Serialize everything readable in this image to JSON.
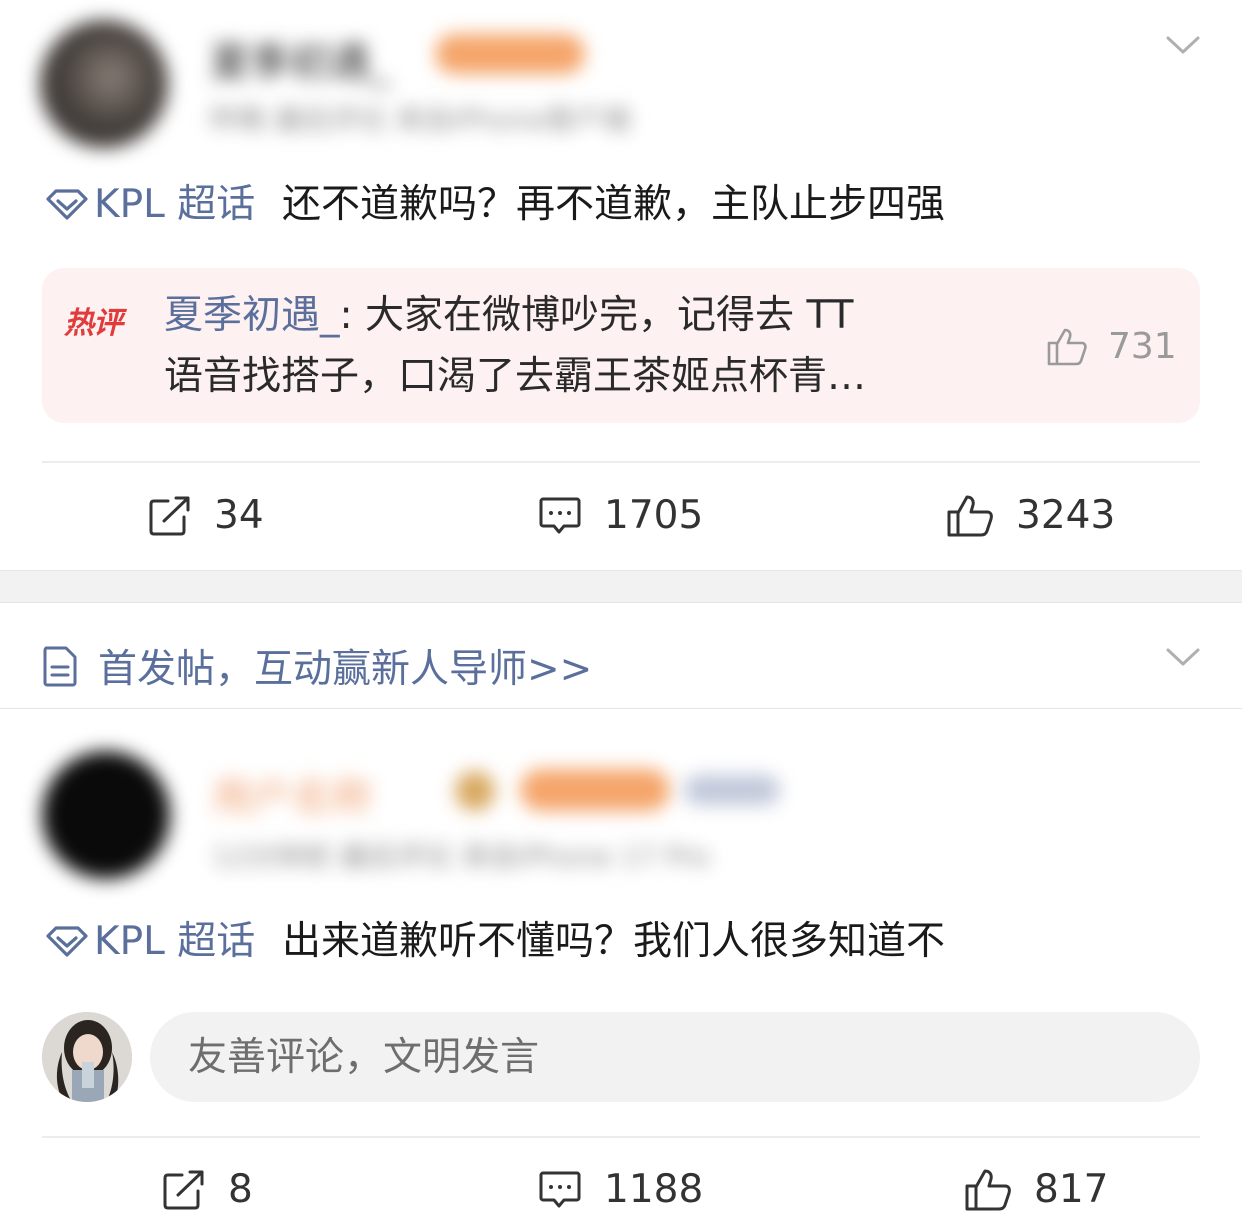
{
  "post1": {
    "user_name": "夏季初遇_",
    "meta": "昨晚 最后评论 来自iPhone客户端",
    "topic_tag": "KPL 超话",
    "text": "还不道歉吗？再不道歉，主队止步四强",
    "hot_comment": {
      "badge": "热评",
      "author": "夏季初遇_",
      "line1": ": 大家在微博吵完，记得去 TT",
      "line2": "语音找搭子，口渴了去霸王茶姬点杯青…",
      "likes": "731"
    },
    "actions": {
      "reposts": "34",
      "comments": "1705",
      "likes": "3243"
    }
  },
  "notice": {
    "text": "首发帖，互动赢新人导师>>"
  },
  "post2": {
    "user_name": "用户名称",
    "meta": "12分钟前 最后评论 来自iPhone 17 Pro",
    "topic_tag": "KPL 超话",
    "text": "出来道歉听不懂吗？我们人很多知道不",
    "comment_input": {
      "placeholder": "友善评论，文明发言"
    },
    "actions": {
      "reposts": "8",
      "comments": "1188",
      "likes": "817"
    }
  },
  "colors": {
    "link": "#5a6f9c",
    "hot_badge": "#e23b3b",
    "hot_bg": "#fdf1f1",
    "vip_badge": "#f5a56a"
  },
  "icons": [
    "chevron-down-icon",
    "diamond-icon",
    "share-icon",
    "comment-icon",
    "thumbs-up-icon",
    "document-icon"
  ]
}
